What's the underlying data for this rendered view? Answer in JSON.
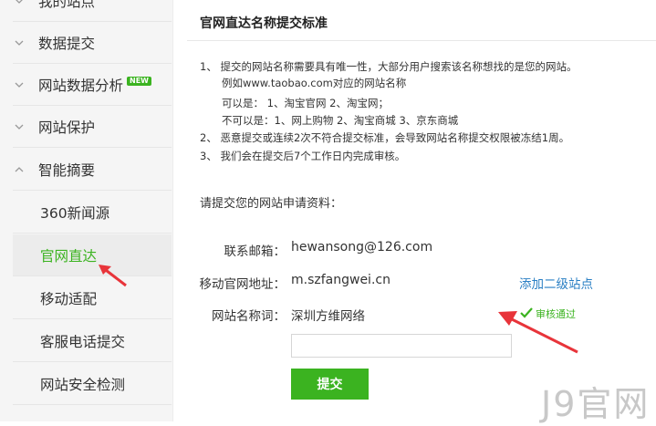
{
  "sidebar": {
    "partial_top": "我的站点",
    "items": [
      {
        "label": "数据提交"
      },
      {
        "label": "网站数据分析",
        "badge": "NEW"
      },
      {
        "label": "网站保护"
      },
      {
        "label": "智能摘要"
      },
      {
        "label": "360新闻源"
      },
      {
        "label": "官网直达"
      },
      {
        "label": "移动适配"
      },
      {
        "label": "客服电话提交"
      },
      {
        "label": "网站安全检测"
      }
    ]
  },
  "main": {
    "title": "官网直达名称提交标准",
    "rules": [
      "1、 提交的网站名称需要具有唯一性，大部分用户搜索该名称想找的是您的网站。",
      "例如www.taobao.com对应的网站名称",
      "可以是： 1、淘宝官网 2、淘宝网；",
      "不可以是：1、网上购物 2、淘宝商城 3、京东商城",
      "2、 恶意提交或连续2次不符合提交标准，会导致网站名称提交权限被冻结1周。",
      "3、 我们会在提交后7个工作日内完成审核。"
    ],
    "section_label": "请提交您的网站申请资料：",
    "form": {
      "email_label": "联系邮箱：",
      "email_value": "hewansong@126.com",
      "mobile_label": "移动官网地址：",
      "mobile_value": "m.szfangwei.cn",
      "add_link": "添加二级站点",
      "name_label": "网站名称词：",
      "name_value": "深圳方维网络",
      "status": "审核通过",
      "submit": "提交"
    }
  },
  "watermark": "J9官网",
  "colors": {
    "accent": "#3bb320",
    "link": "#2a7fc4",
    "arrow": "#e8343a"
  }
}
